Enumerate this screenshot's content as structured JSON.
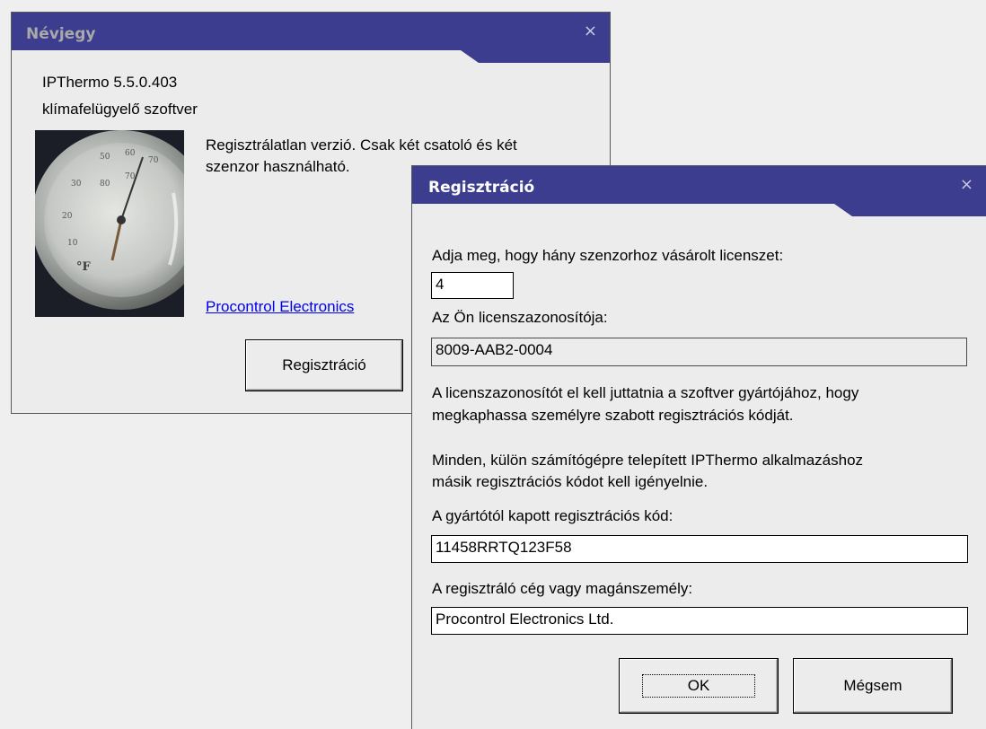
{
  "about": {
    "title": "Névjegy",
    "close_glyph": "×",
    "app_name": "IPThermo  5.5.0.403",
    "app_desc": "klímafelügyelő szoftver",
    "unreg_line1": "Regisztrálatlan verzió. Csak két csatoló és két",
    "unreg_line2": "szenzor használható.",
    "link": "Procontrol Electronics",
    "register_button": "Regisztráció"
  },
  "register": {
    "title": "Regisztráció",
    "close_glyph": "×",
    "sensor_label": "Adja meg, hogy hány szenzorhoz vásárolt licenszet:",
    "sensor_value": "4",
    "license_label": "Az Ön licenszazonosítója:",
    "license_value": "8009-AAB2-0004",
    "info1_line1": "A licenszazonosítót el kell juttatnia a szoftver gyártójához, hogy",
    "info1_line2": "megkaphassa személyre szabott regisztrációs kódját.",
    "info2_line1": "Minden, külön számítógépre telepített IPThermo alkalmazáshoz",
    "info2_line2": "másik regisztrációs kódot kell igényelnie.",
    "code_label": "A gyártótól kapott regisztrációs kód:",
    "code_value": "11458RRTQ123F58",
    "owner_label": "A regisztráló cég vagy magánszemély:",
    "owner_value": "Procontrol Electronics Ltd.",
    "ok_button": "OK",
    "cancel_button": "Mégsem"
  },
  "colors": {
    "titlebar": "#3d3d8f",
    "title_text_about": "#a9a9a9",
    "title_text_register": "#ffffff",
    "link": "#0000ee"
  }
}
